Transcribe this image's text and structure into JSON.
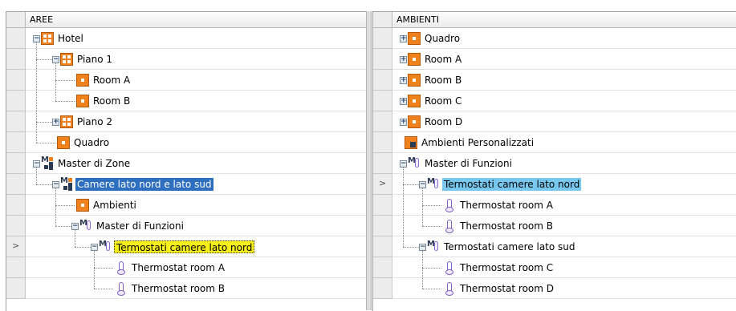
{
  "left_panel": {
    "header": "AREE",
    "rows": [
      {
        "label": "Hotel"
      },
      {
        "label": "Piano 1"
      },
      {
        "label": "Room A"
      },
      {
        "label": "Room B"
      },
      {
        "label": "Piano 2"
      },
      {
        "label": "Quadro"
      },
      {
        "label": "Master di Zone"
      },
      {
        "label": "Camere lato nord e lato sud"
      },
      {
        "label": "Ambienti"
      },
      {
        "label": "Master di Funzioni"
      },
      {
        "label": "Termostati camere lato nord"
      },
      {
        "label": "Thermostat room A"
      },
      {
        "label": "Thermostat room B"
      }
    ]
  },
  "right_panel": {
    "header": "AMBIENTI",
    "rows": [
      {
        "label": "Quadro"
      },
      {
        "label": "Room A"
      },
      {
        "label": "Room B"
      },
      {
        "label": "Room C"
      },
      {
        "label": "Room D"
      },
      {
        "label": "Ambienti Personalizzati"
      },
      {
        "label": "Master di Funzioni"
      },
      {
        "label": "Termostati camere lato nord"
      },
      {
        "label": "Thermostat room A"
      },
      {
        "label": "Thermostat room B"
      },
      {
        "label": "Termostati camere lato sud"
      },
      {
        "label": "Thermostat room C"
      },
      {
        "label": "Thermostat room D"
      }
    ]
  },
  "icons": {
    "building": "building-icon",
    "room": "room-icon",
    "master_zone": "master-zone-icon",
    "master_function": "master-function-icon",
    "thermostat": "thermostat-icon",
    "custom_area": "custom-area-icon"
  },
  "colors": {
    "selection_blue": "#2f6fc0",
    "selection_light_blue": "#78c7ee",
    "selection_yellow": "#f7ef18",
    "room_orange": "#f0821e"
  }
}
